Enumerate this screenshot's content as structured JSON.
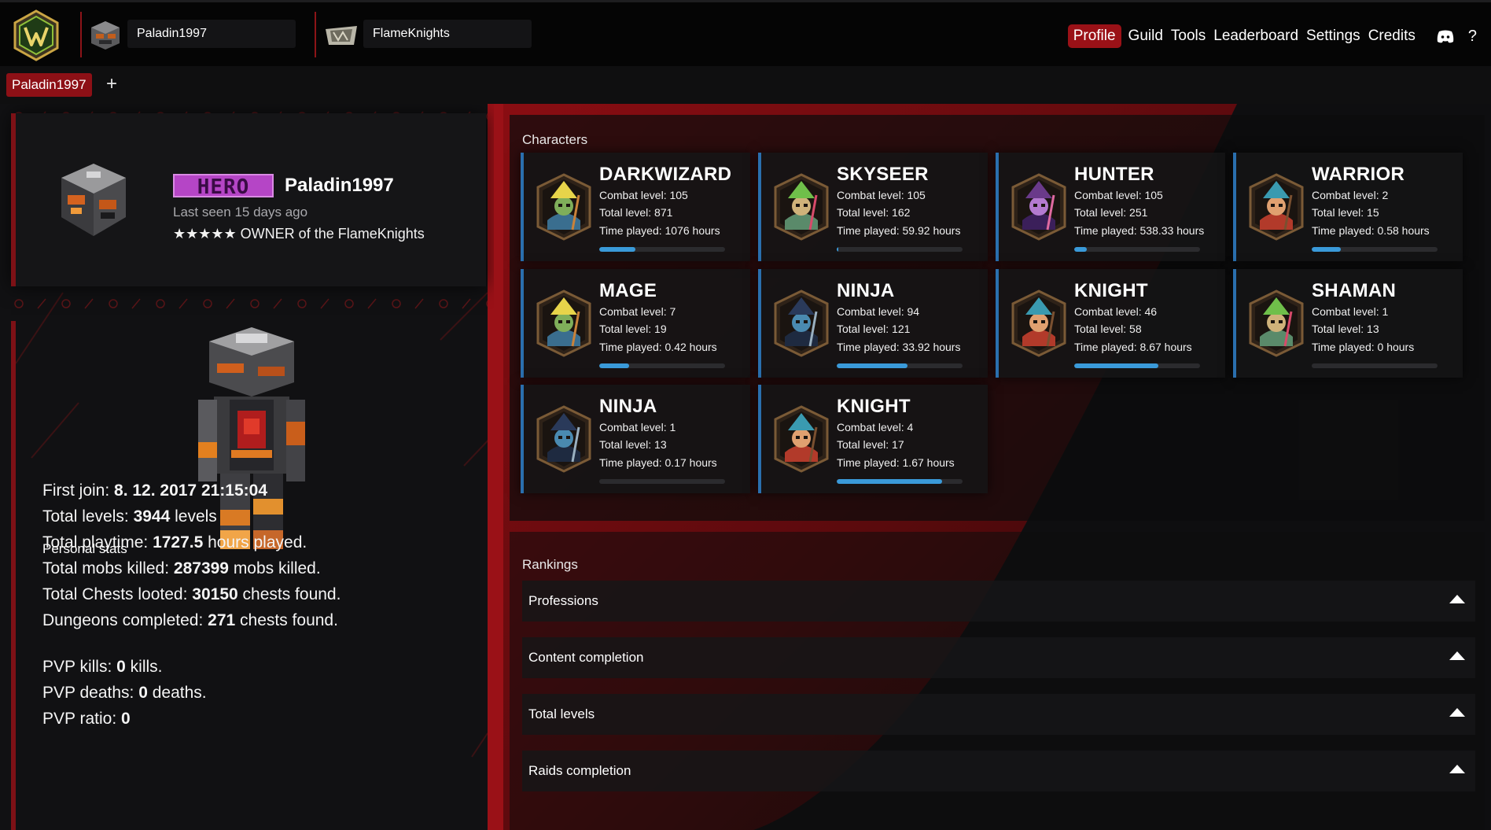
{
  "topbar": {
    "player_name": "Paladin1997",
    "guild_name": "FlameKnights",
    "nav": [
      "Profile",
      "Guild",
      "Tools",
      "Leaderboard",
      "Settings",
      "Credits"
    ],
    "help": "?"
  },
  "tabs": {
    "active": "Paladin1997",
    "add": "+"
  },
  "profile": {
    "rank_badge": "HERO",
    "name": "Paladin1997",
    "last_seen": "Last seen 15 days ago",
    "owner_line": "★★★★★ OWNER of the FlameKnights"
  },
  "stats": {
    "title": "Personal stats",
    "lines": [
      {
        "label": "First join: ",
        "value": "8. 12. 2017 21:15:04",
        "suffix": ""
      },
      {
        "label": "Total levels: ",
        "value": "3944",
        "suffix": " levels"
      },
      {
        "label": "Total playtime: ",
        "value": "1727.5",
        "suffix": " hours played."
      },
      {
        "label": "Total mobs killed: ",
        "value": "287399",
        "suffix": " mobs killed."
      },
      {
        "label": "Total Chests looted: ",
        "value": "30150",
        "suffix": " chests found."
      },
      {
        "label": "Dungeons completed: ",
        "value": "271",
        "suffix": " chests found."
      },
      {
        "label": "PVP kills: ",
        "value": "0",
        "suffix": " kills."
      },
      {
        "label": "PVP deaths: ",
        "value": "0",
        "suffix": " deaths."
      },
      {
        "label": "PVP ratio: ",
        "value": "0",
        "suffix": ""
      }
    ]
  },
  "characters": {
    "title": "Characters",
    "items": [
      {
        "name": "DARKWIZARD",
        "combat": "Combat level: 105",
        "total": "Total level: 871",
        "time": "Time played: 1076 hours",
        "progress": 0.29,
        "icon": "wizard-icon"
      },
      {
        "name": "SKYSEER",
        "combat": "Combat level: 105",
        "total": "Total level: 162",
        "time": "Time played: 59.92 hours",
        "progress": 0.01,
        "icon": "shaman-icon"
      },
      {
        "name": "HUNTER",
        "combat": "Combat level: 105",
        "total": "Total level: 251",
        "time": "Time played: 538.33 hours",
        "progress": 0.1,
        "icon": "archer-icon"
      },
      {
        "name": "WARRIOR",
        "combat": "Combat level: 2",
        "total": "Total level: 15",
        "time": "Time played: 0.58 hours",
        "progress": 0.23,
        "icon": "warrior-icon"
      },
      {
        "name": "MAGE",
        "combat": "Combat level: 7",
        "total": "Total level: 19",
        "time": "Time played: 0.42 hours",
        "progress": 0.24,
        "icon": "wizard-icon"
      },
      {
        "name": "NINJA",
        "combat": "Combat level: 94",
        "total": "Total level: 121",
        "time": "Time played: 33.92 hours",
        "progress": 0.56,
        "icon": "assassin-icon"
      },
      {
        "name": "KNIGHT",
        "combat": "Combat level: 46",
        "total": "Total level: 58",
        "time": "Time played: 8.67 hours",
        "progress": 0.67,
        "icon": "warrior-icon"
      },
      {
        "name": "SHAMAN",
        "combat": "Combat level: 1",
        "total": "Total level: 13",
        "time": "Time played: 0 hours",
        "progress": 0.0,
        "icon": "shaman-icon"
      },
      {
        "name": "NINJA",
        "combat": "Combat level: 1",
        "total": "Total level: 13",
        "time": "Time played: 0.17 hours",
        "progress": 0.0,
        "icon": "assassin-icon"
      },
      {
        "name": "KNIGHT",
        "combat": "Combat level: 4",
        "total": "Total level: 17",
        "time": "Time played: 1.67 hours",
        "progress": 0.84,
        "icon": "warrior-icon"
      }
    ]
  },
  "rankings": {
    "title": "Rankings",
    "rows": [
      "Professions",
      "Content completion",
      "Total levels",
      "Raids completion"
    ]
  },
  "colors": {
    "accent_red": "#9a1117",
    "progress_blue": "#3a9ad9",
    "hero_purple": "#b545c6"
  }
}
